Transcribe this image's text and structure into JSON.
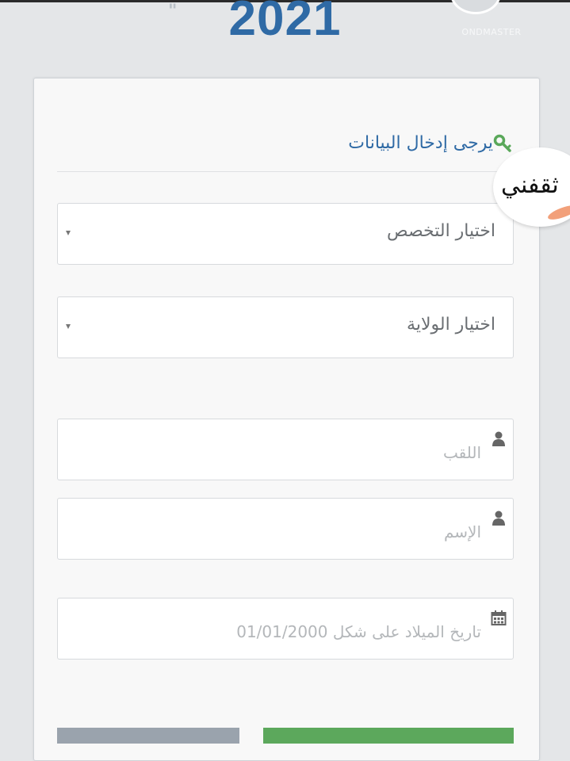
{
  "header": {
    "year": "2021",
    "logo_text": "ONDMASTER"
  },
  "form": {
    "title": "يرجى إدخال البيانات",
    "specialty_select": "اختيار التخصص",
    "state_select": "اختيار الولاية",
    "lastname_placeholder": "اللقب",
    "firstname_placeholder": "الإسم",
    "birthdate_placeholder": "تاريخ الميلاد على شكل 01/01/2000"
  },
  "sticker": {
    "text": "ثقفني"
  },
  "colors": {
    "accent_blue": "#2f6aa5",
    "key_green": "#5aa85a",
    "submit_green": "#5ca85c",
    "reset_gray": "#9aa3ad"
  }
}
